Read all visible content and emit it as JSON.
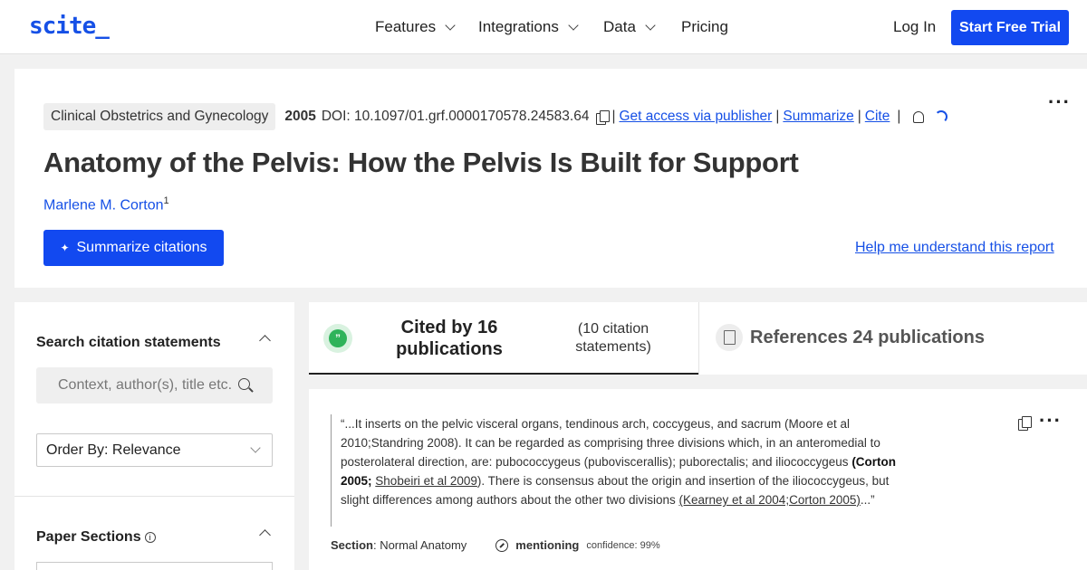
{
  "nav": {
    "logo": "scite_",
    "items": [
      {
        "label": "Features",
        "dropdown": true
      },
      {
        "label": "Integrations",
        "dropdown": true
      },
      {
        "label": "Data",
        "dropdown": true
      },
      {
        "label": "Pricing",
        "dropdown": false
      }
    ],
    "login": "Log In",
    "trial": "Start Free Trial"
  },
  "paper": {
    "journal": "Clinical Obstetrics and Gynecology",
    "year": "2005",
    "doi": "DOI: 10.1097/01.grf.0000170578.24583.64",
    "links": [
      "Get access via publisher",
      "Summarize",
      "Cite"
    ],
    "title": "Anatomy of the Pelvis: How the Pelvis Is Built for Support",
    "author": "Marlene M. Corton",
    "author_sup": "1",
    "summarize_btn": "Summarize citations",
    "help_link": "Help me understand this report"
  },
  "sidebar": {
    "search_heading": "Search citation statements",
    "search_placeholder": "Context, author(s), title etc.",
    "order_by": "Order By: Relevance",
    "sections_heading": "Paper Sections"
  },
  "tabs": {
    "cited_by": "Cited by 16 publications",
    "citation_statements": "(10 citation statements)",
    "references": "References 24 publications"
  },
  "citation": {
    "text_1": "“...It inserts on the pelvic visceral organs, tendinous arch, coccygeus, and sacrum (Moore et al 2010;Standring 2008). It can be regarded as comprising three divisions which, in an anteromedial to posterolateral direction, are: pubococcygeus (puboviscerallis); puborectalis; and iliococcygeus ",
    "bold_ref": "(Corton 2005;",
    "link_1": "Shobeiri et al 2009",
    "text_2": "). There is consensus about the origin and insertion of the iliococcygeus, but slight differences among authors about the other two divisions ",
    "link_2": "(Kearney et al 2004;Corton 2005)",
    "text_3": "...”",
    "section_label": "Section",
    "section_value": ": Normal Anatomy",
    "type": "mentioning",
    "confidence": "confidence: 99%"
  }
}
